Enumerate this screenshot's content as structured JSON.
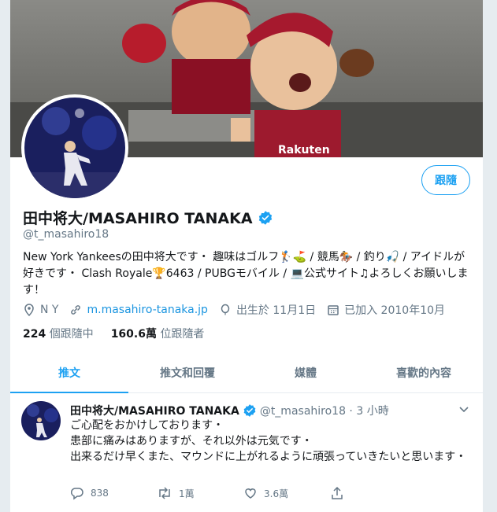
{
  "profile": {
    "display_name": "田中将大/MASAHIRO TANAKA",
    "handle": "@t_masahiro18",
    "follow_label": "跟隨",
    "bio": "New York Yankeesの田中将大です・ 趣味はゴルフ🏌⛳ / 競馬🏇 / 釣り🎣 / アイドルが好きです・ Clash Royale🏆6463 / PUBGモバイル / 💻公式サイト♫よろしくお願いします！",
    "location": "N Y",
    "website": "m.masahiro-tanaka.jp",
    "birthday": "出生於 11月1日",
    "joined": "已加入 2010年10月",
    "following_count": "224",
    "following_label": "個跟隨中",
    "followers_count": "160.6萬",
    "followers_label": "位跟隨者"
  },
  "tabs": [
    {
      "label": "推文"
    },
    {
      "label": "推文和回覆"
    },
    {
      "label": "媒體"
    },
    {
      "label": "喜歡的內容"
    }
  ],
  "tweet": {
    "name": "田中将大/MASAHIRO TANAKA",
    "handle_time": "@t_masahiro18 · 3 小時",
    "lines": [
      "ご心配をおかけしております・",
      "患部に痛みはありますが、それ以外は元気です・",
      "出来るだけ早くまた、マウンドに上がれるように頑張っていきたいと思います・"
    ],
    "replies": "838",
    "retweets": "1萬",
    "likes": "3.6萬"
  },
  "colors": {
    "accent": "#1da1f2",
    "muted": "#657786",
    "verified": "#1da1f2"
  }
}
